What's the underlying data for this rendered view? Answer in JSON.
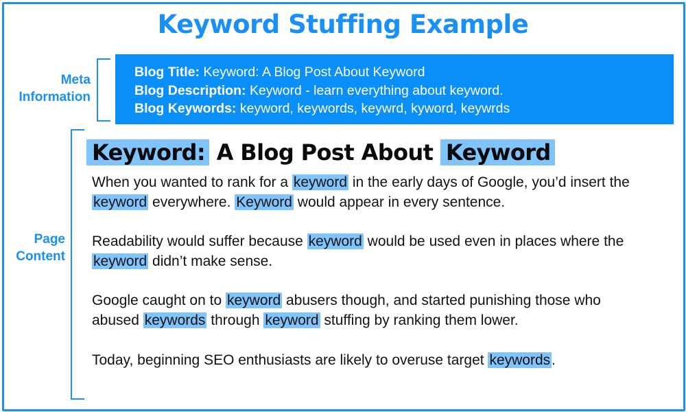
{
  "title": "Keyword Stuffing Example",
  "colors": {
    "accent": "#1a8ff5",
    "meta_box": "#0a8ff8",
    "highlight": "#80c4fd"
  },
  "labels": {
    "meta": [
      "Meta",
      "Information"
    ],
    "content": [
      "Page",
      "Content"
    ]
  },
  "meta": {
    "title_label": "Blog Title:",
    "title_value": "Keyword: A Blog Post About Keyword",
    "description_label": "Blog Description:",
    "description_value": "Keyword - learn everything about keyword.",
    "keywords_label": "Blog Keywords:",
    "keywords_value": "keyword, keywords, keywrd, kyword, keywrds"
  },
  "post": {
    "heading": [
      {
        "t": "Keyword:",
        "hl": true
      },
      {
        "t": " A Blog Post About ",
        "hl": false
      },
      {
        "t": "Keyword",
        "hl": true
      }
    ],
    "paragraphs": [
      [
        {
          "t": "When you wanted to rank for a ",
          "hl": false
        },
        {
          "t": "keyword",
          "hl": true
        },
        {
          "t": " in the early days of Google, you’d insert the ",
          "hl": false
        },
        {
          "t": "keyword",
          "hl": true
        },
        {
          "t": " everywhere. ",
          "hl": false
        },
        {
          "t": "Keyword",
          "hl": true
        },
        {
          "t": " would appear in every sentence.",
          "hl": false
        }
      ],
      [
        {
          "t": "Readability would suffer because ",
          "hl": false
        },
        {
          "t": "keyword",
          "hl": true
        },
        {
          "t": " would be used even in places where the ",
          "hl": false
        },
        {
          "t": "keyword",
          "hl": true
        },
        {
          "t": " didn’t make sense.",
          "hl": false
        }
      ],
      [
        {
          "t": "Google caught on to ",
          "hl": false
        },
        {
          "t": "keyword",
          "hl": true
        },
        {
          "t": " abusers though, and started punishing those who abused ",
          "hl": false
        },
        {
          "t": "keywords",
          "hl": true
        },
        {
          "t": " through ",
          "hl": false
        },
        {
          "t": "keyword",
          "hl": true
        },
        {
          "t": " stuffing by ranking them lower.",
          "hl": false
        }
      ],
      [
        {
          "t": "Today, beginning SEO enthusiasts are likely to overuse target ",
          "hl": false
        },
        {
          "t": "keywords",
          "hl": true
        },
        {
          "t": ".",
          "hl": false
        }
      ]
    ]
  }
}
